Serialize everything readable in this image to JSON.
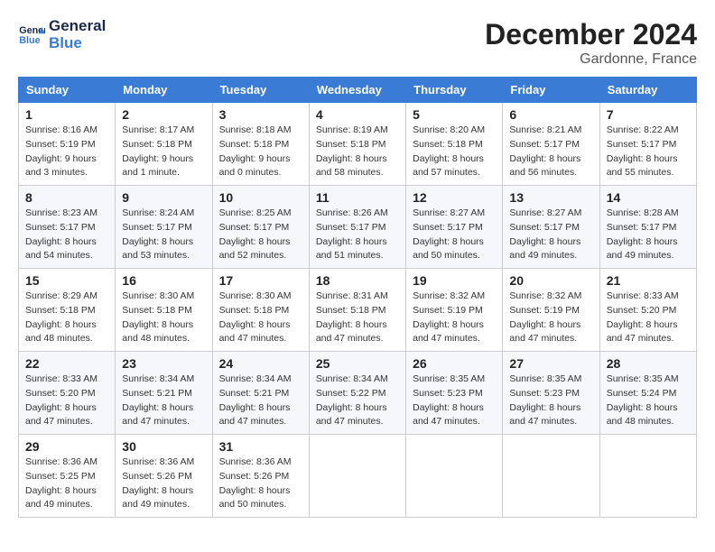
{
  "header": {
    "logo_line1": "General",
    "logo_line2": "Blue",
    "month": "December 2024",
    "location": "Gardonne, France"
  },
  "days_of_week": [
    "Sunday",
    "Monday",
    "Tuesday",
    "Wednesday",
    "Thursday",
    "Friday",
    "Saturday"
  ],
  "weeks": [
    [
      {
        "day": "1",
        "sunrise": "8:16 AM",
        "sunset": "5:19 PM",
        "daylight": "9 hours and 3 minutes."
      },
      {
        "day": "2",
        "sunrise": "8:17 AM",
        "sunset": "5:18 PM",
        "daylight": "9 hours and 1 minute."
      },
      {
        "day": "3",
        "sunrise": "8:18 AM",
        "sunset": "5:18 PM",
        "daylight": "9 hours and 0 minutes."
      },
      {
        "day": "4",
        "sunrise": "8:19 AM",
        "sunset": "5:18 PM",
        "daylight": "8 hours and 58 minutes."
      },
      {
        "day": "5",
        "sunrise": "8:20 AM",
        "sunset": "5:18 PM",
        "daylight": "8 hours and 57 minutes."
      },
      {
        "day": "6",
        "sunrise": "8:21 AM",
        "sunset": "5:17 PM",
        "daylight": "8 hours and 56 minutes."
      },
      {
        "day": "7",
        "sunrise": "8:22 AM",
        "sunset": "5:17 PM",
        "daylight": "8 hours and 55 minutes."
      }
    ],
    [
      {
        "day": "8",
        "sunrise": "8:23 AM",
        "sunset": "5:17 PM",
        "daylight": "8 hours and 54 minutes."
      },
      {
        "day": "9",
        "sunrise": "8:24 AM",
        "sunset": "5:17 PM",
        "daylight": "8 hours and 53 minutes."
      },
      {
        "day": "10",
        "sunrise": "8:25 AM",
        "sunset": "5:17 PM",
        "daylight": "8 hours and 52 minutes."
      },
      {
        "day": "11",
        "sunrise": "8:26 AM",
        "sunset": "5:17 PM",
        "daylight": "8 hours and 51 minutes."
      },
      {
        "day": "12",
        "sunrise": "8:27 AM",
        "sunset": "5:17 PM",
        "daylight": "8 hours and 50 minutes."
      },
      {
        "day": "13",
        "sunrise": "8:27 AM",
        "sunset": "5:17 PM",
        "daylight": "8 hours and 49 minutes."
      },
      {
        "day": "14",
        "sunrise": "8:28 AM",
        "sunset": "5:17 PM",
        "daylight": "8 hours and 49 minutes."
      }
    ],
    [
      {
        "day": "15",
        "sunrise": "8:29 AM",
        "sunset": "5:18 PM",
        "daylight": "8 hours and 48 minutes."
      },
      {
        "day": "16",
        "sunrise": "8:30 AM",
        "sunset": "5:18 PM",
        "daylight": "8 hours and 48 minutes."
      },
      {
        "day": "17",
        "sunrise": "8:30 AM",
        "sunset": "5:18 PM",
        "daylight": "8 hours and 47 minutes."
      },
      {
        "day": "18",
        "sunrise": "8:31 AM",
        "sunset": "5:18 PM",
        "daylight": "8 hours and 47 minutes."
      },
      {
        "day": "19",
        "sunrise": "8:32 AM",
        "sunset": "5:19 PM",
        "daylight": "8 hours and 47 minutes."
      },
      {
        "day": "20",
        "sunrise": "8:32 AM",
        "sunset": "5:19 PM",
        "daylight": "8 hours and 47 minutes."
      },
      {
        "day": "21",
        "sunrise": "8:33 AM",
        "sunset": "5:20 PM",
        "daylight": "8 hours and 47 minutes."
      }
    ],
    [
      {
        "day": "22",
        "sunrise": "8:33 AM",
        "sunset": "5:20 PM",
        "daylight": "8 hours and 47 minutes."
      },
      {
        "day": "23",
        "sunrise": "8:34 AM",
        "sunset": "5:21 PM",
        "daylight": "8 hours and 47 minutes."
      },
      {
        "day": "24",
        "sunrise": "8:34 AM",
        "sunset": "5:21 PM",
        "daylight": "8 hours and 47 minutes."
      },
      {
        "day": "25",
        "sunrise": "8:34 AM",
        "sunset": "5:22 PM",
        "daylight": "8 hours and 47 minutes."
      },
      {
        "day": "26",
        "sunrise": "8:35 AM",
        "sunset": "5:23 PM",
        "daylight": "8 hours and 47 minutes."
      },
      {
        "day": "27",
        "sunrise": "8:35 AM",
        "sunset": "5:23 PM",
        "daylight": "8 hours and 47 minutes."
      },
      {
        "day": "28",
        "sunrise": "8:35 AM",
        "sunset": "5:24 PM",
        "daylight": "8 hours and 48 minutes."
      }
    ],
    [
      {
        "day": "29",
        "sunrise": "8:36 AM",
        "sunset": "5:25 PM",
        "daylight": "8 hours and 49 minutes."
      },
      {
        "day": "30",
        "sunrise": "8:36 AM",
        "sunset": "5:26 PM",
        "daylight": "8 hours and 49 minutes."
      },
      {
        "day": "31",
        "sunrise": "8:36 AM",
        "sunset": "5:26 PM",
        "daylight": "8 hours and 50 minutes."
      },
      null,
      null,
      null,
      null
    ]
  ],
  "labels": {
    "sunrise": "Sunrise:",
    "sunset": "Sunset:",
    "daylight": "Daylight:"
  }
}
